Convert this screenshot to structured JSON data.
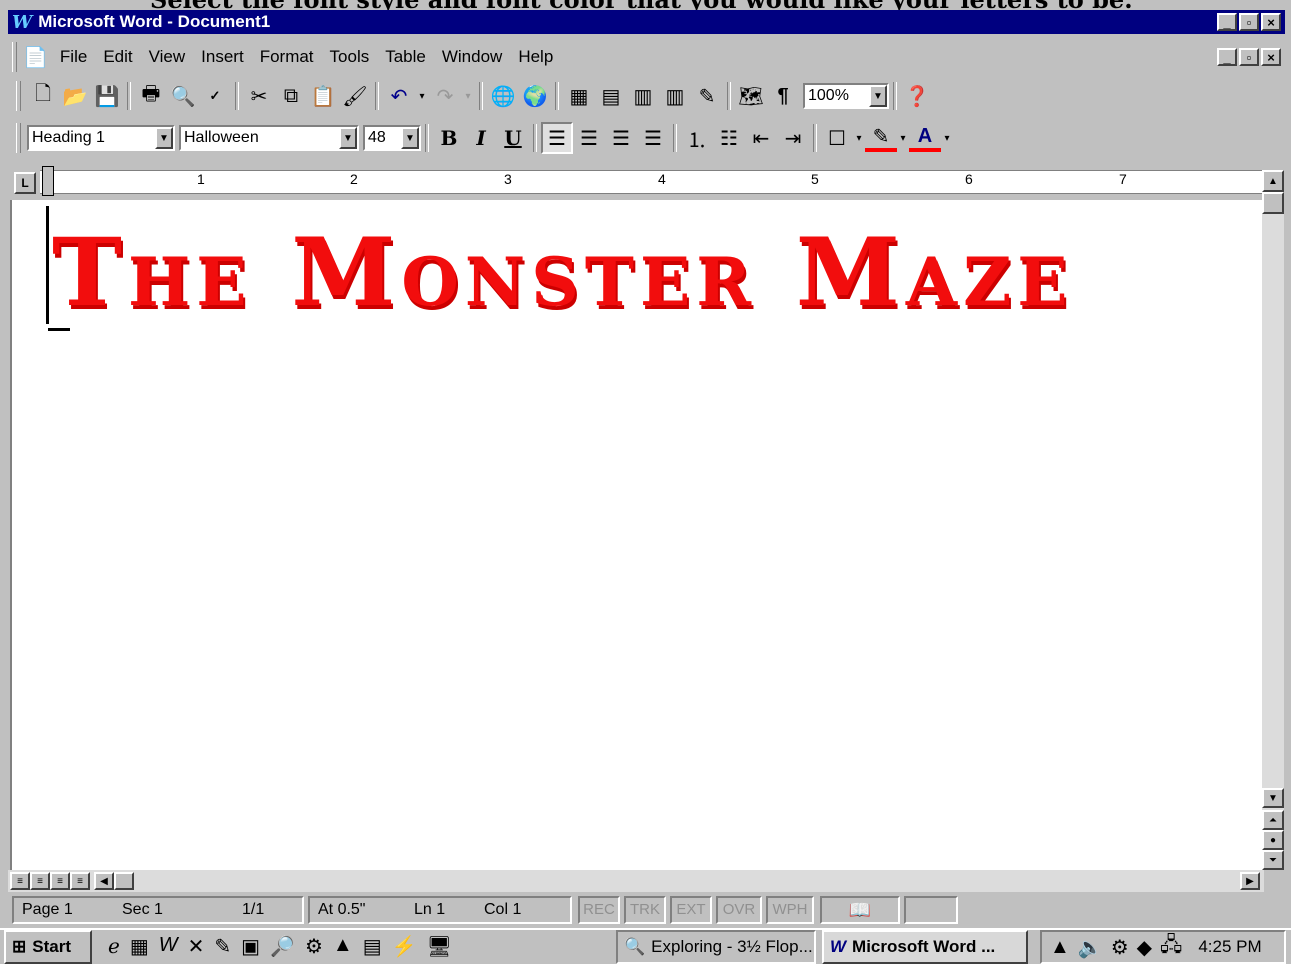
{
  "caption": "Select the font style and font color that you would like your letters to be.",
  "window": {
    "title": "Microsoft Word - Document1",
    "controls": [
      "_",
      "□",
      "×"
    ]
  },
  "menu": {
    "items": [
      "File",
      "Edit",
      "View",
      "Insert",
      "Format",
      "Tools",
      "Table",
      "Window",
      "Help"
    ]
  },
  "standard_toolbar": {
    "zoom": "100%"
  },
  "formatting_toolbar": {
    "style": "Heading 1",
    "font": "Halloween",
    "size": "48",
    "bold": "B",
    "italic": "I",
    "underline": "U",
    "highlight_color": "#ff0000",
    "font_color": "#ff0000"
  },
  "ruler": {
    "numbers": [
      "1",
      "2",
      "3",
      "4",
      "5",
      "6",
      "7"
    ]
  },
  "document": {
    "heading": "The Monster Maze",
    "heading_color": "#f20d0d"
  },
  "status_bar": {
    "page": "Page 1",
    "sec": "Sec 1",
    "pages": "1/1",
    "at": "At 0.5\"",
    "ln": "Ln 1",
    "col": "Col 1",
    "modes": [
      "REC",
      "TRK",
      "EXT",
      "OVR",
      "WPH"
    ]
  },
  "taskbar": {
    "start": "Start",
    "tasks": [
      "Exploring - 3½ Flop...",
      "Microsoft Word ..."
    ],
    "clock": "4:25 PM"
  }
}
